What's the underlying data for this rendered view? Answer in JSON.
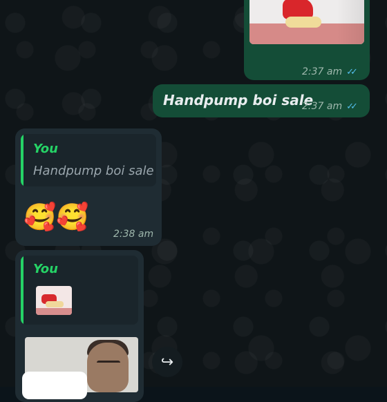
{
  "chat": {
    "msg1": {
      "time": "2:37 am",
      "status": "read"
    },
    "msg2": {
      "text": "Handpump boi sale",
      "time": "2:37 am",
      "status": "read"
    },
    "msg3": {
      "quote_author": "You",
      "quote_text": "Handpump boi sale",
      "body": "🥰🥰",
      "time": "2:38 am"
    },
    "msg4": {
      "quote_author": "You"
    }
  },
  "icons": {
    "ticks": "✓✓",
    "forward": "↪"
  },
  "colors": {
    "outgoing_bubble": "#144d37",
    "incoming_bubble": "#1f2c33",
    "quote_accent": "#25d366",
    "read_ticks": "#53bdeb"
  }
}
